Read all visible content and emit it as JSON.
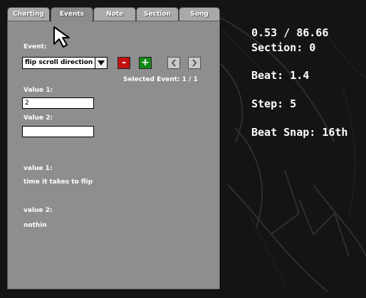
{
  "tabs": [
    "Charting",
    "Events",
    "Note",
    "Section",
    "Song"
  ],
  "active_tab": "Events",
  "panel": {
    "event_label": "Event:",
    "event_dropdown": "flip scroll direction",
    "remove_label": "-",
    "add_label": "+",
    "selected_event": "Selected Event: 1 / 1",
    "value1_label": "Value 1:",
    "value1_input": "2",
    "value2_label": "Value 2:",
    "value2_input": "",
    "desc1_title": "value 1:",
    "desc1_text": "time it takes to flip",
    "desc2_title": "value 2:",
    "desc2_text": "nothin"
  },
  "stats": {
    "time": "0.53 / 86.66",
    "section": "Section: 0",
    "beat": "Beat: 1.4",
    "step": "Step: 5",
    "beat_snap": "Beat Snap: 16th"
  },
  "colors": {
    "panel": "#8e8e8e",
    "tab": "#a9a9a9",
    "remove_button": "#c21212",
    "add_button": "#128c18",
    "background": "#141414"
  },
  "icons": {
    "remove": "minus-icon",
    "add": "plus-icon",
    "previous": "chevron-left-icon",
    "next": "chevron-right-icon",
    "dropdown": "triangle-down-icon",
    "cursor": "mouse-pointer-icon"
  }
}
